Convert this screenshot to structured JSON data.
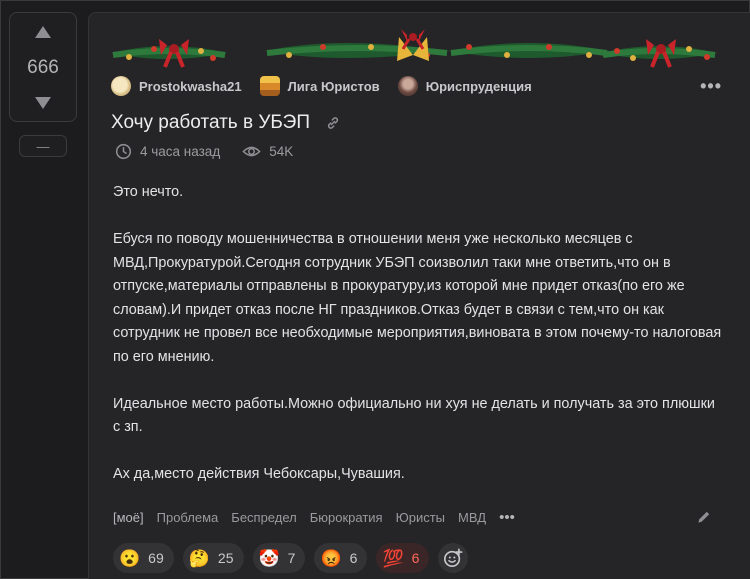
{
  "vote": {
    "rating": "666",
    "minus_label": "—"
  },
  "post": {
    "author": "Prostokwasha21",
    "community": "Лига Юристов",
    "category": "Юриспруденция",
    "title": "Хочу работать в УБЭП",
    "time": "4 часа назад",
    "views": "54K",
    "paragraphs": [
      "Это нечто.",
      "Ебуся по поводу мошенничества в отношении меня уже несколько месяцев с МВД,Прокуратурой.Сегодня сотрудник УБЭП соизволил таки мне ответить,что он в отпуске,материалы отправлены в прокуратуру,из которой мне придет отказ(по его же словам).И придет отказ после НГ праздников.Отказ будет в связи с тем,что он как сотрудник не провел все необходимые мероприятия,виновата в этом почему-то налоговая по его мнению.",
      "Идеальное место работы.Можно официально ни хуя не делать и получать за это плюшки с зп.",
      "Ах да,место действия Чебоксары,Чувашия."
    ],
    "tags": [
      "[моё]",
      "Проблема",
      "Беспредел",
      "Бюрократия",
      "Юристы",
      "МВД"
    ]
  },
  "reactions": [
    {
      "emoji": "😮",
      "count": "69"
    },
    {
      "emoji": "🤔",
      "count": "25"
    },
    {
      "emoji": "🤡",
      "count": "7"
    },
    {
      "emoji": "😡",
      "count": "6"
    },
    {
      "emoji": "💯",
      "count": "6"
    }
  ],
  "colors": {
    "background": "#1c1c1e",
    "card": "#252527",
    "accent_red": "#ff6a5a",
    "muted": "#9c9ca0"
  },
  "icons": [
    "arrow-up-icon",
    "arrow-down-icon",
    "link-icon",
    "clock-icon",
    "eye-icon",
    "more-icon",
    "pencil-icon",
    "add-reaction-icon"
  ]
}
